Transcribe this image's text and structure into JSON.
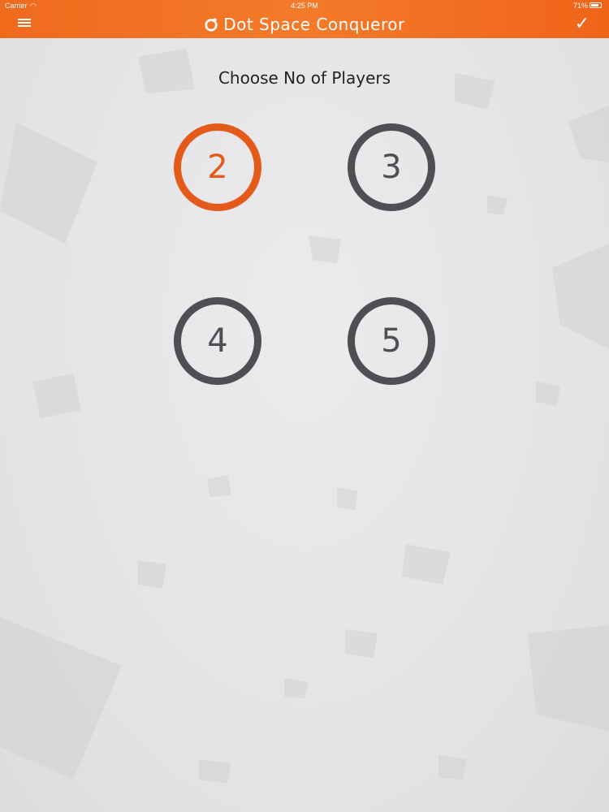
{
  "status_bar": {
    "carrier": "Carrier",
    "time": "4:25 PM",
    "battery": "71%"
  },
  "header": {
    "title": "Dot Space Conqueror",
    "menu_icon": "hamburger-menu-icon",
    "confirm_icon": "checkmark-icon",
    "confirm_glyph": "✓",
    "color": "#f47a2a"
  },
  "main": {
    "heading": "Choose No of Players",
    "options": [
      {
        "label": "2",
        "selected": true
      },
      {
        "label": "3",
        "selected": false
      },
      {
        "label": "4",
        "selected": false
      },
      {
        "label": "5",
        "selected": false
      }
    ],
    "selected_color": "#e35a1a",
    "default_color": "#4f4f53"
  }
}
